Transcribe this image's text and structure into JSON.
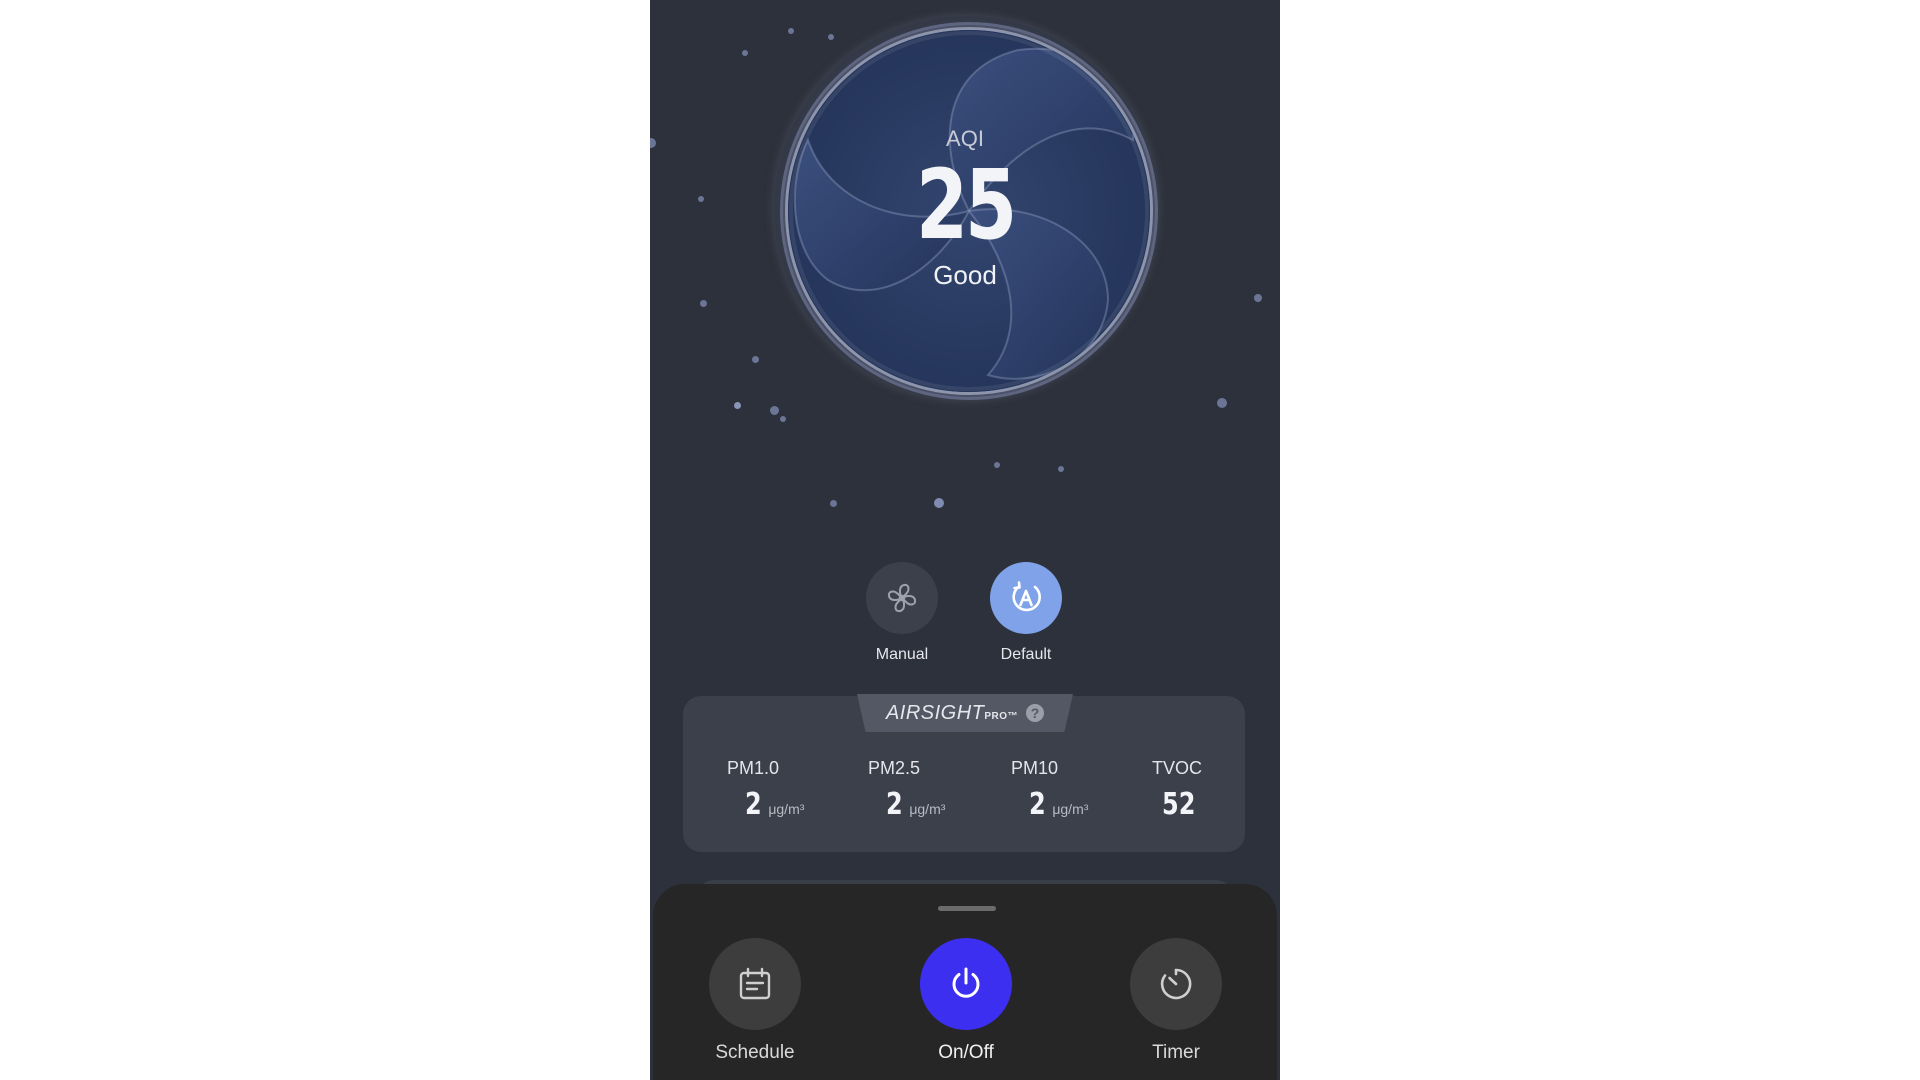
{
  "aqi": {
    "label": "AQI",
    "value": "25",
    "status": "Good"
  },
  "modes": [
    {
      "label": "Manual",
      "icon": "fan-icon",
      "active": false
    },
    {
      "label": "Default",
      "icon": "auto-mode-icon",
      "active": true
    }
  ],
  "airsight": {
    "logo_main": "AIRSIGHT",
    "logo_sub": "PRO",
    "logo_tm": "™",
    "help_glyph": "?",
    "metrics": [
      {
        "name": "PM1.0",
        "value": "2",
        "unit": "μg/m³"
      },
      {
        "name": "PM2.5",
        "value": "2",
        "unit": "μg/m³"
      },
      {
        "name": "PM10",
        "value": "2",
        "unit": "μg/m³"
      },
      {
        "name": "TVOC",
        "value": "52",
        "unit": ""
      }
    ]
  },
  "actions": [
    {
      "label": "Schedule",
      "icon": "calendar-icon"
    },
    {
      "label": "On/Off",
      "icon": "power-icon"
    },
    {
      "label": "Timer",
      "icon": "timer-icon"
    }
  ],
  "colors": {
    "background": "#2d313b",
    "accent_power": "#3d2ff0",
    "mode_active": "#7fa2e8",
    "sheet": "#262626"
  }
}
